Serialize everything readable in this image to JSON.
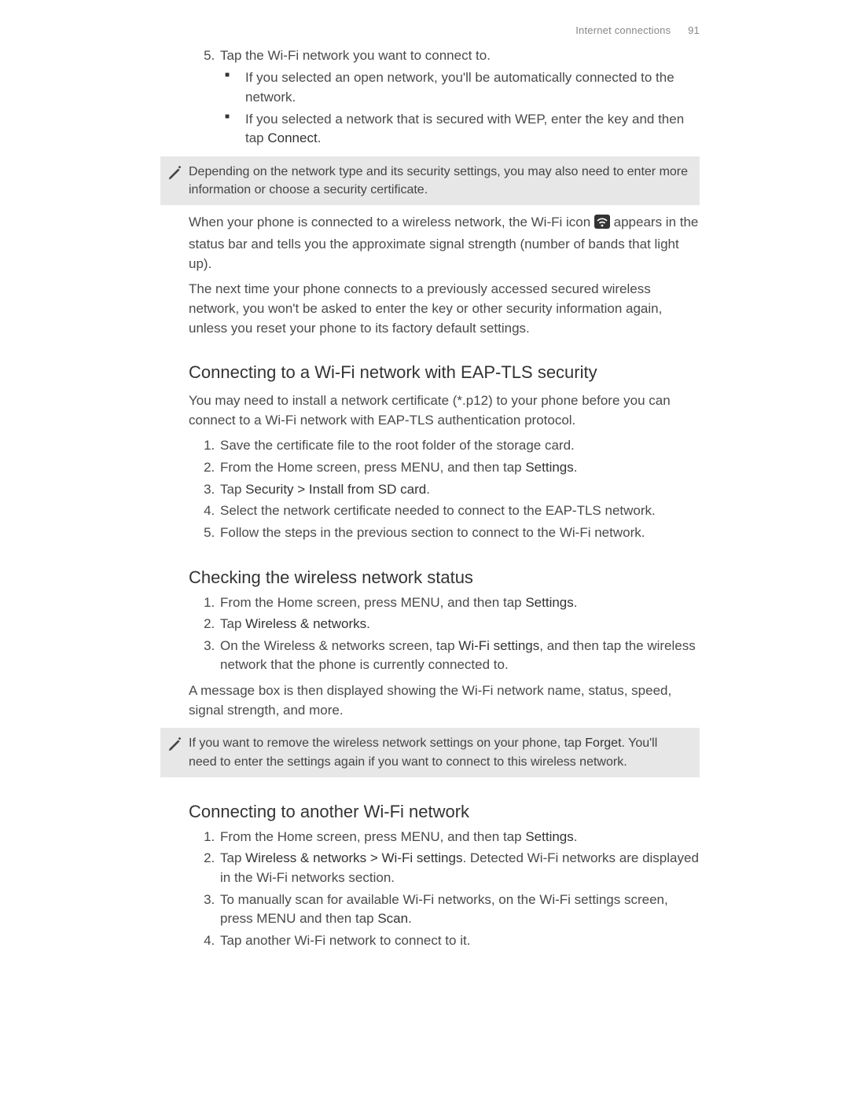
{
  "header": {
    "section": "Internet connections",
    "page": "91"
  },
  "step5": {
    "text": "Tap the Wi-Fi network you want to connect to.",
    "bullets": [
      {
        "text": "If you selected an open network, you'll be automatically connected to the network."
      },
      {
        "pre": "If you selected a network that is secured with WEP, enter the key and then tap ",
        "bold": "Connect",
        "post": "."
      }
    ]
  },
  "note1": "Depending on the network type and its security settings, you may also need to enter more information or choose a security certificate.",
  "para_wifi": {
    "pre": "When your phone is connected to a wireless network, the Wi-Fi icon ",
    "post": " appears in the status bar and tells you the approximate signal strength (number of bands that light up)."
  },
  "para_nexttime": "The next time your phone connects to a previously accessed secured wireless network, you won't be asked to enter the key or other security information again, unless you reset your phone to its factory default settings.",
  "eap": {
    "heading": "Connecting to a Wi-Fi network with EAP-TLS security",
    "intro": "You may need to install a network certificate (*.p12) to your phone before you can connect to a Wi-Fi network with EAP-TLS authentication protocol.",
    "steps": {
      "s1": "Save the certificate file to the root folder of the storage card.",
      "s2": {
        "pre": "From the Home screen, press MENU, and then tap ",
        "bold": "Settings",
        "post": "."
      },
      "s3": {
        "pre": "Tap ",
        "bold": "Security > Install from SD card",
        "post": "."
      },
      "s4": "Select the network certificate needed to connect to the EAP-TLS network.",
      "s5": "Follow the steps in the previous section to connect to the Wi-Fi network."
    }
  },
  "check": {
    "heading": "Checking the wireless network status",
    "steps": {
      "s1": {
        "pre": "From the Home screen, press MENU, and then tap ",
        "bold": "Settings",
        "post": "."
      },
      "s2": {
        "pre": "Tap ",
        "bold": "Wireless & networks",
        "post": "."
      },
      "s3": {
        "pre": "On the Wireless & networks screen, tap ",
        "bold": "Wi-Fi settings",
        "post": ", and then tap the wireless network that the phone is currently connected to."
      }
    },
    "outro": "A message box is then displayed showing the Wi-Fi network name, status, speed, signal strength, and more."
  },
  "note2": {
    "pre": "If you want to remove the wireless network settings on your phone, tap ",
    "bold": "Forget",
    "post": ". You'll need to enter the settings again if you want to connect to this wireless network."
  },
  "another": {
    "heading": "Connecting to another Wi-Fi network",
    "steps": {
      "s1": {
        "pre": "From the Home screen, press MENU, and then tap ",
        "bold": "Settings",
        "post": "."
      },
      "s2": {
        "pre": "Tap ",
        "bold": "Wireless & networks > Wi-Fi settings",
        "post": ". Detected Wi-Fi networks are displayed in the Wi-Fi networks section."
      },
      "s3": {
        "pre": "To manually scan for available Wi-Fi networks, on the Wi-Fi settings screen, press MENU and then tap ",
        "bold": "Scan",
        "post": "."
      },
      "s4": "Tap another Wi-Fi network to connect to it."
    }
  }
}
